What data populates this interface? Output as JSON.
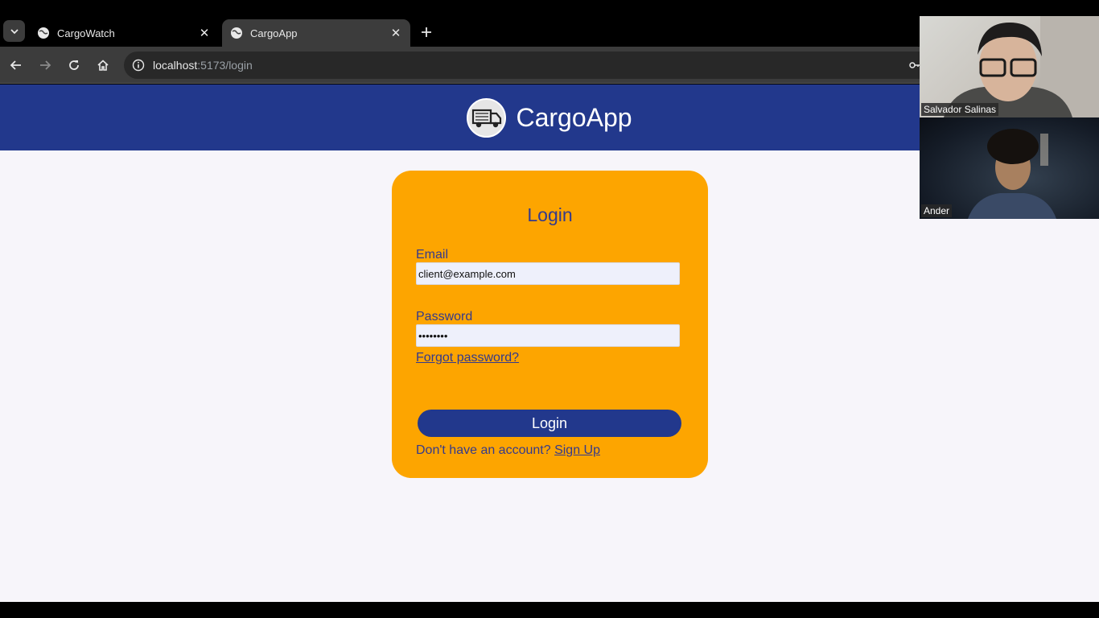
{
  "browser": {
    "tabs": [
      {
        "title": "CargoWatch",
        "active": false
      },
      {
        "title": "CargoApp",
        "active": true
      }
    ],
    "url": {
      "host": "localhost",
      "rest": ":5173/login"
    }
  },
  "header": {
    "brand": "CargoApp"
  },
  "login": {
    "title": "Login",
    "email_label": "Email",
    "email_value": "client@example.com",
    "password_label": "Password",
    "password_value": "••••••••",
    "forgot_label": "Forgot password?",
    "button_label": "Login",
    "signup_prompt": "Don't have an account?",
    "signup_label": "Sign Up"
  },
  "call": {
    "participants": [
      {
        "name": "Salvador Salinas"
      },
      {
        "name": "Ander"
      }
    ]
  },
  "colors": {
    "brand_blue": "#22388c",
    "card_orange": "#fda500",
    "page_bg": "#f7f5fa"
  }
}
